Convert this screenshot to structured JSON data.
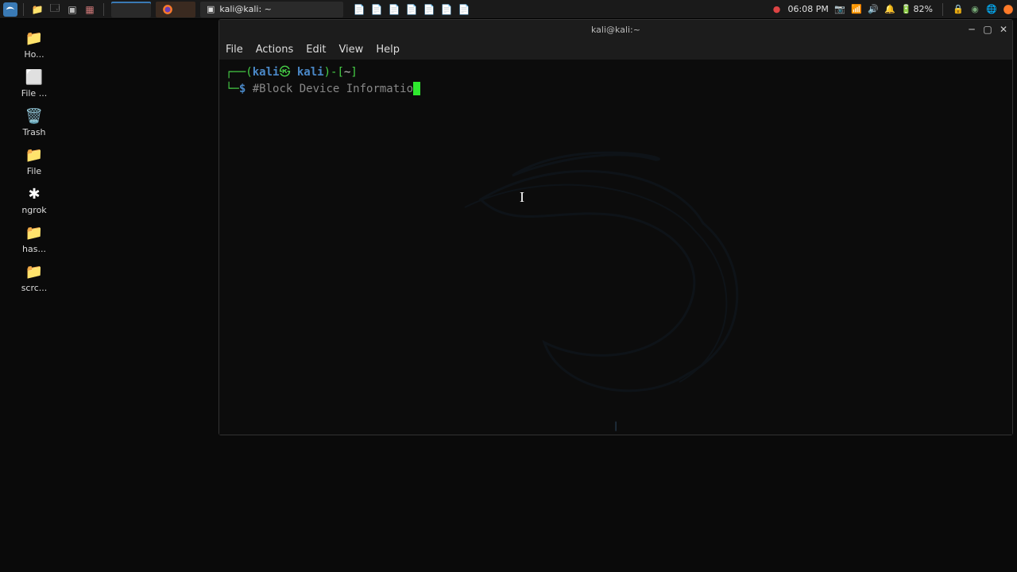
{
  "panel": {
    "taskbar": {
      "terminal_title": "kali@kali: ~"
    },
    "tray": {
      "time": "06:08 PM",
      "battery": "82%"
    }
  },
  "desktop": {
    "items": [
      {
        "label": "Ho...",
        "icon": "folder"
      },
      {
        "label": "File ...",
        "icon": "file"
      },
      {
        "label": "Trash",
        "icon": "trash"
      },
      {
        "label": "File",
        "icon": "folder"
      },
      {
        "label": "ngrok",
        "icon": "gear"
      },
      {
        "label": "has...",
        "icon": "folder"
      },
      {
        "label": "scrc...",
        "icon": "folder"
      }
    ]
  },
  "terminal_window": {
    "title": "kali@kali:~",
    "menubar": [
      "File",
      "Actions",
      "Edit",
      "View",
      "Help"
    ],
    "prompt": {
      "user": "kali",
      "host": "kali",
      "path": "~",
      "symbol": "$",
      "command": "#Block Device Informatio"
    }
  }
}
